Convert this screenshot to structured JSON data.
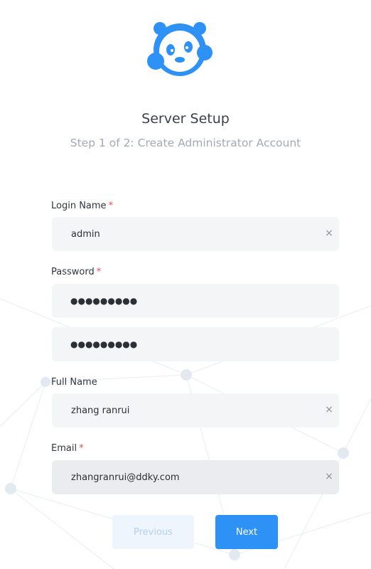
{
  "header": {
    "title": "Server Setup",
    "subtitle": "Step 1 of 2: Create Administrator Account"
  },
  "form": {
    "login_name": {
      "label": "Login Name",
      "required_mark": "*",
      "value": "admin",
      "clear": "×"
    },
    "password": {
      "label": "Password",
      "required_mark": "*",
      "value": "●●●●●●●●●",
      "confirm_value": "●●●●●●●●●"
    },
    "full_name": {
      "label": "Full Name",
      "value": "zhang ranrui",
      "clear": "×"
    },
    "email": {
      "label": "Email",
      "required_mark": "*",
      "value": "zhangranrui@ddky.com",
      "clear": "×"
    }
  },
  "buttons": {
    "previous": "Previous",
    "next": "Next"
  },
  "colors": {
    "accent": "#2e91f5",
    "required": "#f04c4c",
    "input_bg": "#f4f5f7"
  },
  "icons": {
    "logo": "panda-headset-logo",
    "clear": "close-icon"
  }
}
